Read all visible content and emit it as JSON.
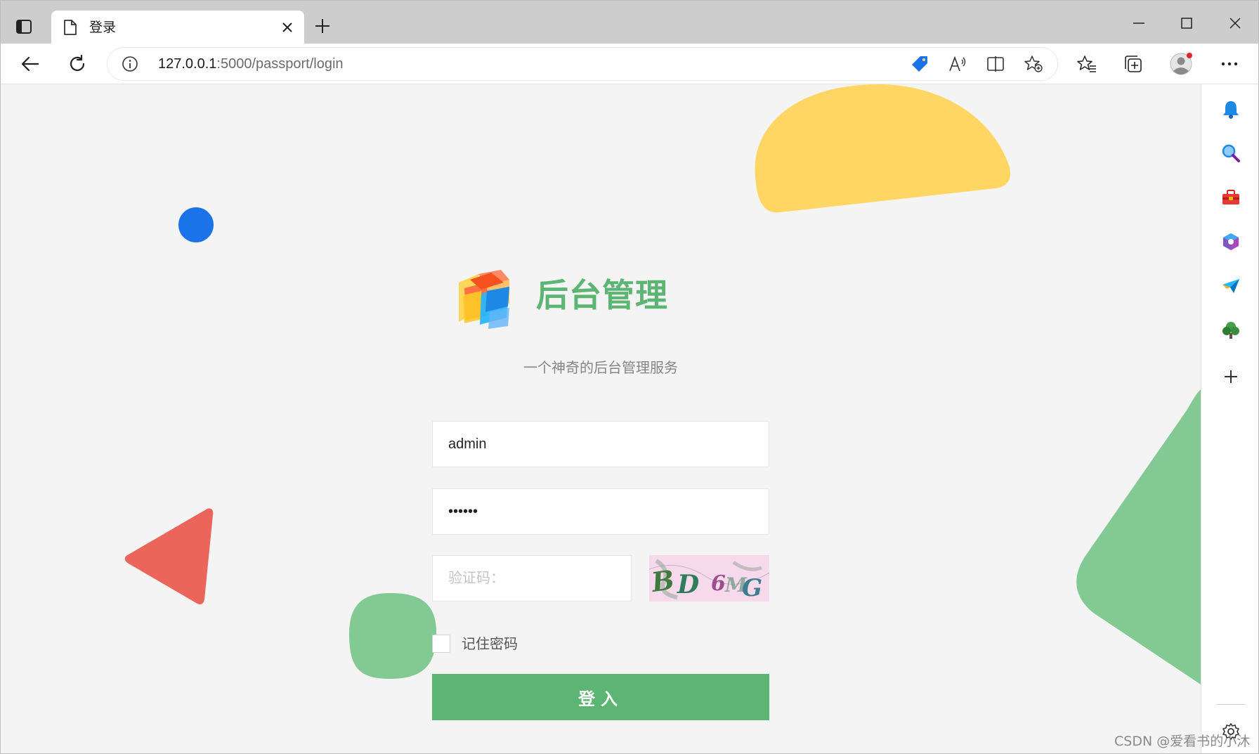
{
  "browser": {
    "tab_title": "登录",
    "url_host": "127.0.0.1",
    "url_path": ":5000/passport/login",
    "icons": {
      "tab_actions": "tab-actions-icon",
      "page": "page-icon",
      "close_tab": "close-icon",
      "new_tab": "plus-icon",
      "back": "back-arrow-icon",
      "refresh": "refresh-icon",
      "site_info": "info-icon",
      "coupon": "tag-icon",
      "read_aloud": "read-aloud-icon",
      "split_screen": "split-screen-icon",
      "add_favorite": "star-add-icon",
      "favorites": "favorites-icon",
      "collections": "collections-icon",
      "profile": "profile-icon",
      "more": "more-icon"
    }
  },
  "sidebar": {
    "items": [
      "bell-icon",
      "search-icon",
      "toolbox-icon",
      "office-icon",
      "send-icon",
      "tree-icon",
      "plus-icon"
    ],
    "settings": "gear-icon"
  },
  "login": {
    "app_title": "后台管理",
    "subtitle": "一个神奇的后台管理服务",
    "username_value": "admin",
    "password_value": "••••••",
    "captcha_placeholder": "验证码：",
    "captcha_text": "BD6MG",
    "remember_label": "记住密码",
    "submit_label": "登入"
  },
  "colors": {
    "accent": "#5cb572",
    "deco_yellow": "#ffd563",
    "deco_blue": "#1a73e8",
    "deco_red": "#ec655a",
    "deco_green": "#82c993",
    "page_bg": "#f4f4f4"
  },
  "watermark": "CSDN @爱看书的小沐"
}
